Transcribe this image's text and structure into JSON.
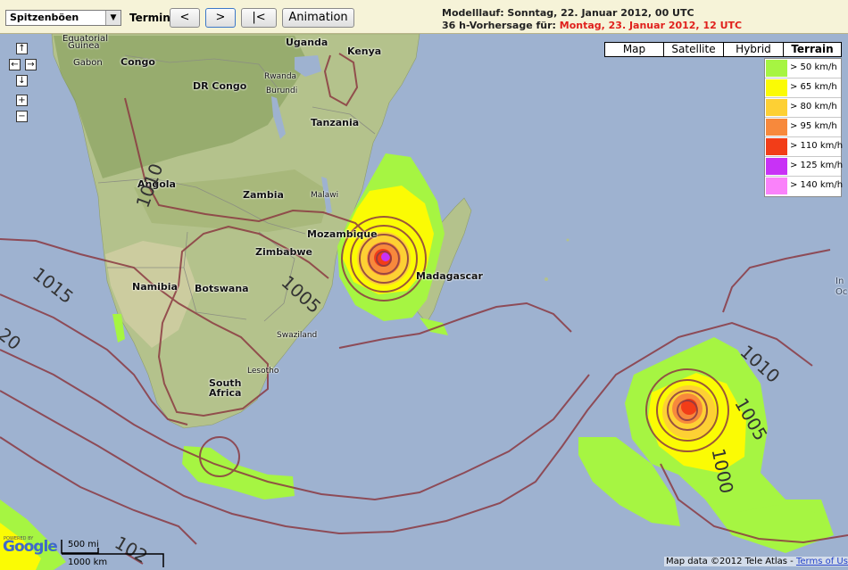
{
  "toolbar": {
    "parameter_select": "Spitzenböen",
    "termin_label": "Termin:",
    "prev_label": "<",
    "next_label": ">",
    "first_label": "|<",
    "animation_label": "Animation",
    "run_text": "Modelllauf: Sonntag, 22. Januar 2012, 00 UTC",
    "forecast_prefix": "36 h-Vorhersage für: ",
    "forecast_date": "Montag, 23. Januar 2012, 12 UTC"
  },
  "map_types": [
    "Map",
    "Satellite",
    "Hybrid",
    "Terrain"
  ],
  "selected_map_type": "Terrain",
  "legend": [
    {
      "label": "> 50 km/h",
      "color": "#a6f542"
    },
    {
      "label": "> 65 km/h",
      "color": "#fbfb04"
    },
    {
      "label": "> 80 km/h",
      "color": "#fdd034"
    },
    {
      "label": "> 95 km/h",
      "color": "#f7893c"
    },
    {
      "label": "> 110 km/h",
      "color": "#f23d18"
    },
    {
      "label": "> 125 km/h",
      "color": "#c832f6"
    },
    {
      "label": "> 140 km/h",
      "color": "#fa82fa"
    }
  ],
  "places": {
    "equatorial_guinea_1": "Equatorial",
    "equatorial_guinea_2": "Guinea",
    "gabon": "Gabon",
    "congo": "Congo",
    "uganda": "Uganda",
    "kenya": "Kenya",
    "rwanda": "Rwanda",
    "burundi": "Burundi",
    "dr_congo": "DR Congo",
    "tanzania": "Tanzania",
    "angola": "Angola",
    "zambia": "Zambia",
    "malawi": "Malawi",
    "mozambique": "Mozambique",
    "zimbabwe": "Zimbabwe",
    "madagascar": "Madagascar",
    "namibia": "Namibia",
    "botswana": "Botswana",
    "swaziland": "Swaziland",
    "lesotho": "Lesotho",
    "south_africa_1": "South",
    "south_africa_2": "Africa",
    "ocean_fragment_1": "In",
    "ocean_fragment_2": "Oc"
  },
  "isobar_labels": [
    "1010",
    "1015",
    "1005",
    "1015",
    "20",
    "1010",
    "1005",
    "1000",
    "102"
  ],
  "nav": {
    "up": "↑",
    "left": "←",
    "right": "→",
    "down": "↓",
    "zoom_in": "+",
    "zoom_out": "−"
  },
  "logo": {
    "powered_by": "POWERED BY",
    "google": "Google"
  },
  "scale": {
    "miles": "500 mi",
    "km": "1000 km"
  },
  "attribution": {
    "text": "Map data ©2012 Tele Atlas - ",
    "link": "Terms of Use"
  }
}
